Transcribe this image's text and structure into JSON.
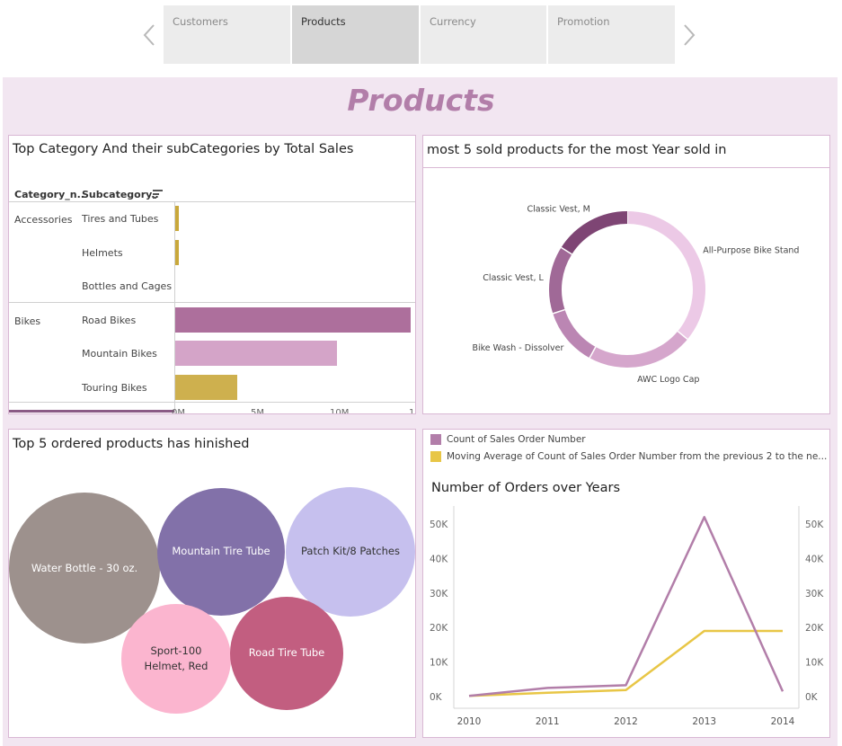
{
  "nav": {
    "tabs": [
      {
        "label": "Customers",
        "active": false
      },
      {
        "label": "Products",
        "active": true
      },
      {
        "label": "Currency",
        "active": false
      },
      {
        "label": "Promotion",
        "active": false
      }
    ]
  },
  "page": {
    "title": "Products"
  },
  "colors": {
    "accent": "#b27ea9",
    "background": "#f2e6f1",
    "gold": "#c9a83b",
    "yellow": "#e8c646"
  },
  "panels": {
    "category": {
      "title": "Top Category And their subCategories by Total Sales",
      "col1": "Category_n..",
      "col2": "Subcategory..",
      "axis_ticks": [
        "0M",
        "5M",
        "10M",
        "15M"
      ]
    },
    "donut": {
      "title": "most 5 sold products   for the most Year sold in"
    },
    "bubbles": {
      "title": "Top 5 ordered products has hinished"
    },
    "orders": {
      "title": "Number of Orders over Years",
      "legend": [
        {
          "label": "Count of Sales Order Number",
          "color": "#b27ea9"
        },
        {
          "label": "Moving Average of Count of Sales Order Number from the previous 2 to the ne...",
          "color": "#e8c646"
        }
      ]
    }
  },
  "chart_data": [
    {
      "type": "bar",
      "title": "Top Category And their subCategories by Total Sales",
      "groups": [
        {
          "category": "Accessories",
          "items": [
            {
              "name": "Tires and Tubes",
              "value": 0.25,
              "color": "#c9a83b"
            },
            {
              "name": "Helmets",
              "value": 0.2,
              "color": "#c9a83b"
            },
            {
              "name": "Bottles and Cages",
              "value": 0,
              "color": "#c9a83b"
            }
          ]
        },
        {
          "category": "Bikes",
          "items": [
            {
              "name": "Road Bikes",
              "value": 14.9,
              "color": "#ad6f9c"
            },
            {
              "name": "Mountain Bikes",
              "value": 10.2,
              "color": "#d4a4c8"
            },
            {
              "name": "Touring Bikes",
              "value": 3.9,
              "color": "#ceb04e"
            }
          ]
        }
      ],
      "xlim": [
        0,
        15
      ],
      "xticks": [
        "0M",
        "5M",
        "10M",
        "15M"
      ]
    },
    {
      "type": "pie",
      "title": "most 5 sold products   for the most Year sold in",
      "donut": true,
      "slices": [
        {
          "label": "All-Purpose Bike Stand",
          "value": 36,
          "color": "#ecc9e6"
        },
        {
          "label": "AWC Logo Cap",
          "value": 22,
          "color": "#d5a6cc"
        },
        {
          "label": "Bike Wash - Dissolver",
          "value": 12,
          "color": "#bb86b3"
        },
        {
          "label": "Classic Vest, L",
          "value": 14,
          "color": "#a06997"
        },
        {
          "label": "Classic Vest, M",
          "value": 16,
          "color": "#7e4574"
        }
      ]
    },
    {
      "type": "scatter",
      "title": "Top 5 ordered products has hinished",
      "bubbles": [
        {
          "label": "Water Bottle - 30 oz.",
          "value": 100,
          "color": "#9d918d",
          "text": "#ffffff"
        },
        {
          "label": "Mountain Tire Tube",
          "value": 72,
          "color": "#8271a9",
          "text": "#ffffff"
        },
        {
          "label": "Patch Kit/8 Patches",
          "value": 74,
          "color": "#c6c0ee",
          "text": "#333333"
        },
        {
          "label": "Sport-100 Helmet, Red",
          "value": 52,
          "color": "#fbb5cf",
          "text": "#333333"
        },
        {
          "label": "Road Tire Tube",
          "value": 56,
          "color": "#c25e80",
          "text": "#ffffff"
        }
      ]
    },
    {
      "type": "line",
      "title": "Number of Orders over Years",
      "x": [
        "2010",
        "2011",
        "2012",
        "2013",
        "2014"
      ],
      "series": [
        {
          "name": "Count of Sales Order Number",
          "values": [
            0.2,
            2.5,
            3.3,
            52,
            1.5
          ],
          "color": "#b27ea9"
        },
        {
          "name": "Moving Average of Count of Sales Order Number from the previous 2 to the ne...",
          "values": [
            0.2,
            1.1,
            1.9,
            19,
            19
          ],
          "color": "#e8c646"
        }
      ],
      "ylim": [
        0,
        50
      ],
      "yticks": [
        "0K",
        "10K",
        "20K",
        "30K",
        "40K",
        "50K"
      ]
    }
  ]
}
